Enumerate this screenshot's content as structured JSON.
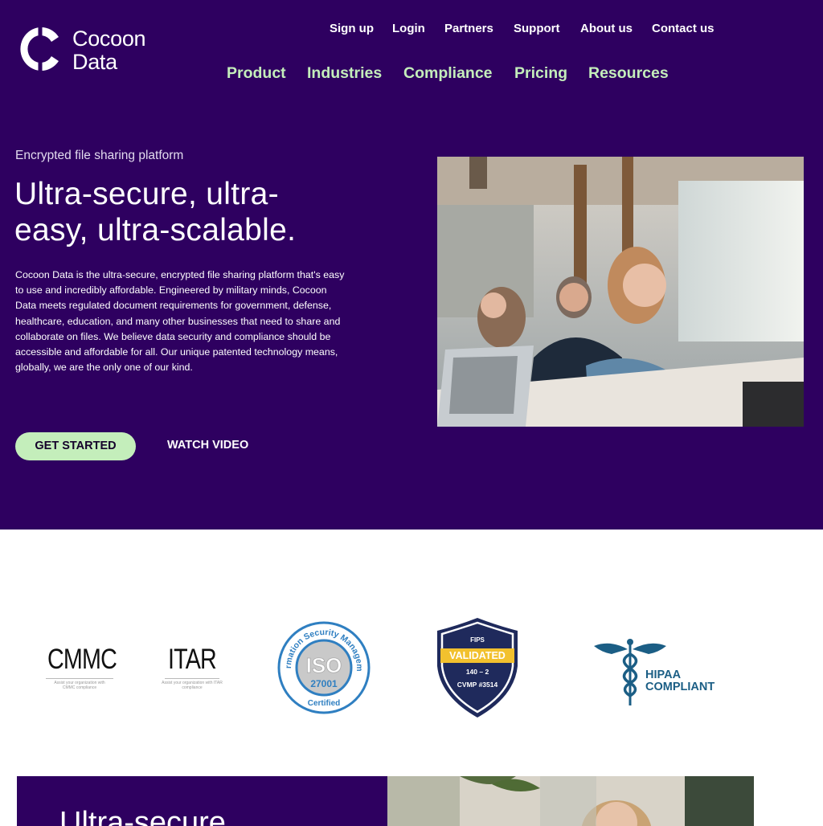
{
  "brand": {
    "name_line1": "Cocoon",
    "name_line2": "Data"
  },
  "top_nav": [
    "Sign up",
    "Login",
    "Partners",
    "Support",
    "About us",
    "Contact us"
  ],
  "main_nav": [
    "Product",
    "Industries",
    "Compliance",
    "Pricing",
    "Resources"
  ],
  "hero": {
    "eyebrow": "Encrypted file sharing platform",
    "headline_line1": "Ultra-secure, ultra-",
    "headline_line2": "easy, ultra-scalable.",
    "description": "Cocoon Data is the ultra-secure, encrypted file sharing platform that's easy to use and incredibly affordable. Engineered by military minds, Cocoon Data meets regulated document requirements for government, defense, healthcare, education, and many other businesses that need to share and collaborate on files. We believe data security and compliance should be accessible and affordable for all. Our unique patented technology means, globally, we are the only one of our kind.",
    "primary_cta": "GET STARTED",
    "secondary_cta": "WATCH VIDEO"
  },
  "badges": {
    "cmmc": {
      "title": "CMMC",
      "caption": "Assist your organization with CMMC compliance"
    },
    "itar": {
      "title": "ITAR",
      "caption": "Assist your organization with ITAR compliance"
    },
    "iso": {
      "ring_text": "Information Security Management",
      "mark": "ISO",
      "number": "27001",
      "bottom": "Certified"
    },
    "fips": {
      "top": "FIPS",
      "validated": "VALIDATED",
      "level": "140 – 2",
      "cert": "CVMP #3514"
    },
    "hipaa": {
      "line1": "HIPAA",
      "line2": "COMPLIANT"
    }
  },
  "next_section": {
    "title": "Ultra-secure"
  },
  "colors": {
    "brand_purple": "#2e0060",
    "accent_green": "#c4eebb",
    "badge_blue": "#2f7fc1",
    "fips_navy": "#1f2a5c",
    "fips_gold": "#f2c12e",
    "hipaa_teal": "#1b5e85"
  }
}
